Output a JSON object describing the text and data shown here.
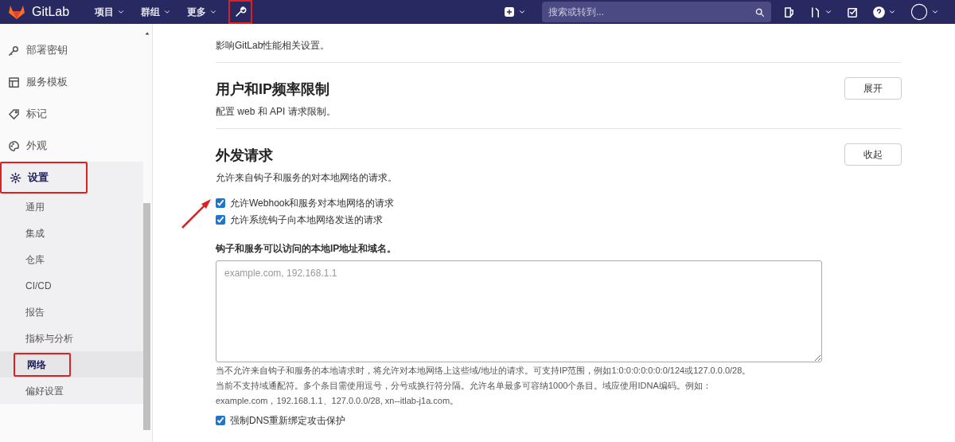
{
  "navbar": {
    "brand": "GitLab",
    "menus": [
      {
        "label": "项目"
      },
      {
        "label": "群组"
      },
      {
        "label": "更多"
      }
    ],
    "admin_annotated": true,
    "search": {
      "placeholder": "搜索或转到..."
    }
  },
  "sidebar": {
    "items": [
      {
        "label": "部署密钥",
        "selected": false,
        "annotated": false
      },
      {
        "label": "服务模板",
        "selected": false,
        "annotated": false
      },
      {
        "label": "标记",
        "selected": false,
        "annotated": false
      },
      {
        "label": "外观",
        "selected": false,
        "annotated": false
      },
      {
        "label": "设置",
        "selected": true,
        "annotated": true,
        "children": [
          {
            "label": "通用",
            "selected": false,
            "annotated": false
          },
          {
            "label": "集成",
            "selected": false,
            "annotated": false
          },
          {
            "label": "仓库",
            "selected": false,
            "annotated": false
          },
          {
            "label": "CI/CD",
            "selected": false,
            "annotated": false
          },
          {
            "label": "报告",
            "selected": false,
            "annotated": false
          },
          {
            "label": "指标与分析",
            "selected": false,
            "annotated": false
          },
          {
            "label": "网络",
            "selected": true,
            "annotated": true
          },
          {
            "label": "偏好设置",
            "selected": false,
            "annotated": false
          }
        ]
      }
    ]
  },
  "sections": [
    {
      "description": "影响GitLab性能相关设置。"
    },
    {
      "title": "用户和IP频率限制",
      "description": "配置 web 和 API 请求限制。",
      "button": "展开"
    },
    {
      "title": "外发请求",
      "description": "允许来自钩子和服务的对本地网络的请求。",
      "button": "收起",
      "checkboxes": [
        {
          "label": "允许Webhook和服务对本地网络的请求",
          "checked": true,
          "annotated": true
        },
        {
          "label": "允许系统钩子向本地网络发送的请求",
          "checked": true
        }
      ],
      "field": {
        "label": "钩子和服务可以访问的本地IP地址和域名。",
        "placeholder": "example.com, 192.168.1.1"
      },
      "help": [
        "当不允许来自钩子和服务的本地请求时，将允许对本地网络上这些域/地址的请求。可支持IP范围，例如1:0:0:0:0:0:0:0/124或127.0.0.0/28。",
        "当前不支持域通配符。多个条目需使用逗号，分号或换行符分隔。允许名单最多可容纳1000个条目。域应使用IDNA编码。例如：",
        "example.com，192.168.1.1、127.0.0.0/28, xn--itlab-j1a.com。"
      ],
      "extra_checkboxes": [
        {
          "label": "强制DNS重新绑定攻击保护",
          "checked": true
        }
      ]
    }
  ]
}
